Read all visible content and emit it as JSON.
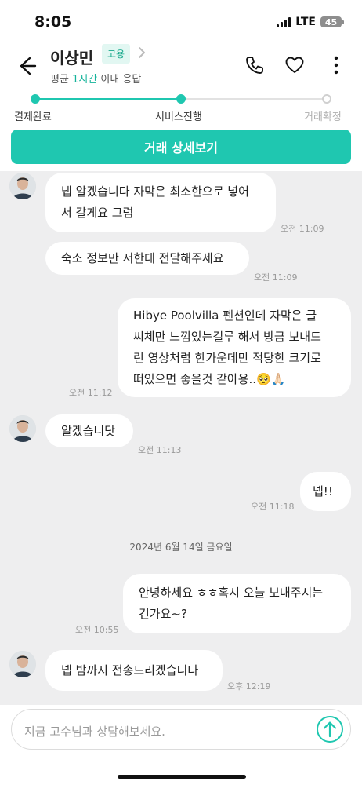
{
  "status": {
    "time": "8:05",
    "network": "LTE",
    "battery": "45"
  },
  "header": {
    "name": "이상민",
    "badge": "고용",
    "response_prefix": "평균 ",
    "response_highlight": "1시간",
    "response_suffix": " 이내 응답",
    "icons": [
      "back-arrow-icon",
      "chevron-right-icon",
      "phone-icon",
      "heart-icon",
      "more-vertical-icon"
    ]
  },
  "progress": {
    "steps": [
      {
        "label": "결제완료",
        "state": "done"
      },
      {
        "label": "서비스진행",
        "state": "current"
      },
      {
        "label": "거래확정",
        "state": "pending"
      }
    ],
    "accent": "#1fc7b0"
  },
  "detail_button": "거래 상세보기",
  "messages": [
    {
      "side": "received",
      "line1": "넵 알겠습니다 자막은 최소한으로 넣어",
      "line2": "서 갈게요 그럼",
      "time": "오전 11:09"
    },
    {
      "side": "received",
      "line1": "숙소 정보만 저한테 전달해주세요",
      "time": "오전 11:09"
    },
    {
      "side": "sent",
      "line1": "Hibye Poolvilla 펜션인데 자막은 글",
      "line2": "씨체만 느낌있는걸루 해서 방금 보내드",
      "line3": "린 영상처럼 한가운데만 적당한 크기로",
      "line4": "떠있으면 좋을것 같아용..🥺🙏🏻",
      "time": "오전 11:12"
    },
    {
      "side": "received",
      "line1": "알겠습니닷",
      "time": "오전 11:13"
    },
    {
      "side": "sent",
      "line1": "넵!!",
      "time": "오전 11:18"
    },
    {
      "side": "sent",
      "line1": "안녕하세요 ㅎㅎ혹시 오늘 보내주시는",
      "line2": "건가요~?",
      "time": "오전 10:55"
    },
    {
      "side": "received",
      "line1": "넵 밤까지 전송드리겠습니다",
      "time": "오후 12:19"
    }
  ],
  "date_separator": "2024년 6월 14일 금요일",
  "composer": {
    "placeholder": "지금 고수님과 상담해보세요."
  }
}
